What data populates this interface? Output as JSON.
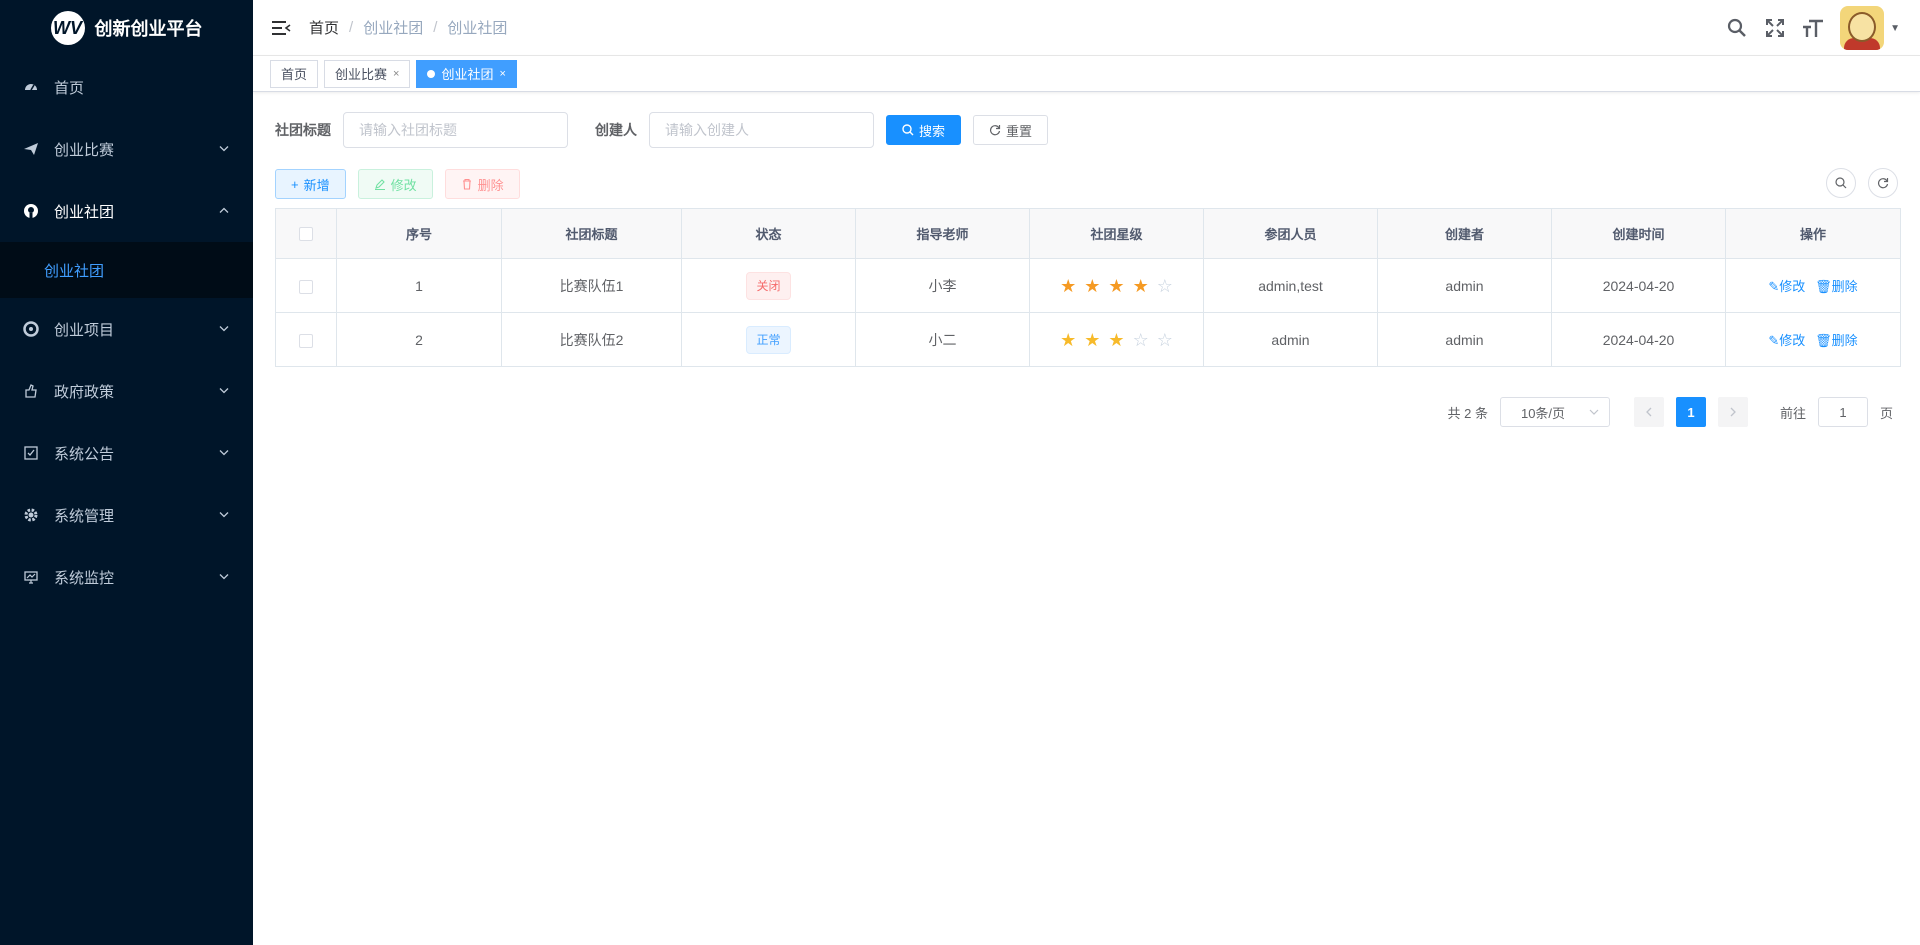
{
  "app": {
    "title": "创新创业平台",
    "logo_text": "WV"
  },
  "sidebar": {
    "items": [
      {
        "label": "首页",
        "icon": "dashboard-icon",
        "has_children": false
      },
      {
        "label": "创业比赛",
        "icon": "send-icon",
        "has_children": true
      },
      {
        "label": "创业社团",
        "icon": "github-icon",
        "has_children": true,
        "expanded": true
      },
      {
        "label": "创业项目",
        "icon": "project-icon",
        "has_children": true
      },
      {
        "label": "政府政策",
        "icon": "policy-icon",
        "has_children": true
      },
      {
        "label": "系统公告",
        "icon": "checkbox-icon",
        "has_children": true
      },
      {
        "label": "系统管理",
        "icon": "gear-icon",
        "has_children": true
      },
      {
        "label": "系统监控",
        "icon": "monitor-icon",
        "has_children": true
      }
    ],
    "submenu": {
      "label": "创业社团"
    }
  },
  "breadcrumb": [
    "首页",
    "创业社团",
    "创业社团"
  ],
  "tags": [
    {
      "label": "首页"
    },
    {
      "label": "创业比赛"
    },
    {
      "label": "创业社团",
      "active": true
    }
  ],
  "search": {
    "title_label": "社团标题",
    "title_placeholder": "请输入社团标题",
    "creator_label": "创建人",
    "creator_placeholder": "请输入创建人",
    "search_btn": "搜索",
    "reset_btn": "重置"
  },
  "toolbar": {
    "add": "新增",
    "edit": "修改",
    "delete": "删除"
  },
  "table": {
    "headers": [
      "序号",
      "社团标题",
      "状态",
      "指导老师",
      "社团星级",
      "参团人员",
      "创建者",
      "创建时间",
      "操作"
    ],
    "rows": [
      {
        "no": "1",
        "title": "比赛队伍1",
        "status": "关闭",
        "status_type": "closed",
        "teacher": "小李",
        "stars": 4,
        "members": "admin,test",
        "creator": "admin",
        "created": "2024-04-20"
      },
      {
        "no": "2",
        "title": "比赛队伍2",
        "status": "正常",
        "status_type": "normal",
        "teacher": "小二",
        "stars": 3,
        "members": "admin",
        "creator": "admin",
        "created": "2024-04-20"
      }
    ],
    "op_edit": "修改",
    "op_delete": "删除"
  },
  "pagination": {
    "total": "共 2 条",
    "page_size": "10条/页",
    "current": "1",
    "goto_label": "前往",
    "goto_value": "1",
    "page_suffix": "页"
  }
}
